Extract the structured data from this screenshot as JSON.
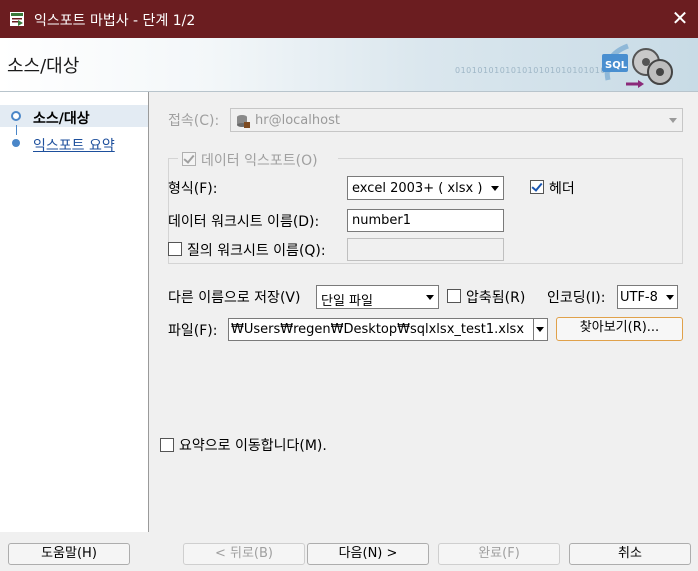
{
  "window": {
    "title": "익스포트 마법사 - 단계 1/2",
    "close_glyph": "✕"
  },
  "header": {
    "title": "소스/대상",
    "binary_text": "0101010101010101010101010101"
  },
  "nav": {
    "items": [
      {
        "label": "소스/대상",
        "active": true
      },
      {
        "label": "익스포트 요약",
        "active": false
      }
    ]
  },
  "form": {
    "connection": {
      "label": "접속(C):",
      "value": "hr@localhost"
    },
    "data_export": {
      "label": "데이터 익스포트(O)",
      "checked": true
    },
    "format": {
      "label": "형식(F):",
      "value": "excel 2003+ ( xlsx )"
    },
    "header_opt": {
      "label": "헤더",
      "checked": true
    },
    "data_sheet": {
      "label": "데이터 워크시트 이름(D):",
      "value": "number1"
    },
    "query_sheet": {
      "label": "질의 워크시트 이름(Q):",
      "value": "",
      "checked": false
    },
    "save_as": {
      "label": "다른 이름으로 저장(V)",
      "value": "단일 파일"
    },
    "compressed": {
      "label": "압축됨(R)",
      "checked": false
    },
    "encoding": {
      "label": "인코딩(I):",
      "value": "UTF-8"
    },
    "file": {
      "label": "파일(F):",
      "value": "₩Users₩regen₩Desktop₩sqlxlsx_test1.xlsx"
    },
    "browse": {
      "label": "찾아보기(R)..."
    },
    "go_summary": {
      "label": "요약으로 이동합니다(M).",
      "checked": false
    }
  },
  "footer": {
    "help": "도움말(H)",
    "back": "< 뒤로(B)",
    "next": "다음(N) >",
    "finish": "완료(F)",
    "cancel": "취소"
  },
  "colors": {
    "titlebar": "#6b1d20",
    "accent": "#4a86c8",
    "focus_border": "#e0a14a"
  }
}
